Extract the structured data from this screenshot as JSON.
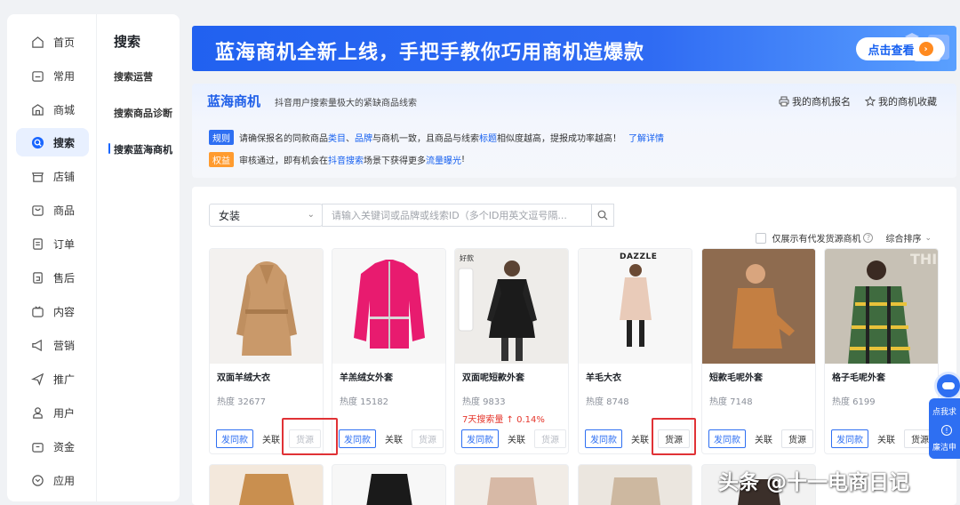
{
  "nav": {
    "items": [
      {
        "label": "首页",
        "icon": "home-icon"
      },
      {
        "label": "常用",
        "icon": "folder-icon"
      },
      {
        "label": "商城",
        "icon": "store-icon"
      },
      {
        "label": "搜索",
        "icon": "search-icon"
      },
      {
        "label": "店铺",
        "icon": "shop-icon"
      },
      {
        "label": "商品",
        "icon": "goods-icon"
      },
      {
        "label": "订单",
        "icon": "order-icon"
      },
      {
        "label": "售后",
        "icon": "aftersale-icon"
      },
      {
        "label": "内容",
        "icon": "tv-icon"
      },
      {
        "label": "营销",
        "icon": "megaphone-icon"
      },
      {
        "label": "推广",
        "icon": "promote-icon"
      },
      {
        "label": "用户",
        "icon": "user-icon"
      },
      {
        "label": "资金",
        "icon": "wallet-icon"
      },
      {
        "label": "应用",
        "icon": "apps-icon"
      }
    ],
    "active_index": 3
  },
  "subnav": {
    "title": "搜索",
    "items": [
      "搜索运营",
      "搜索商品诊断",
      "搜索蓝海商机"
    ],
    "active_index": 2
  },
  "banner": {
    "text": "蓝海商机全新上线，手把手教你巧用商机造爆款",
    "button": "点击查看"
  },
  "info": {
    "logo": "蓝海商机",
    "subtitle": "抖音用户搜索量极大的紧缺商品线索",
    "link_apply": "我的商机报名",
    "link_fav": "我的商机收藏",
    "rule_tag": "规则",
    "rule_text_1": "请确保报名的同款商品",
    "rule_hl_1": "类目",
    "rule_sep": "、",
    "rule_hl_2": "品牌",
    "rule_text_2": "与商机一致，且商品与线索",
    "rule_hl_3": "标题",
    "rule_text_3": "相似度越高，提报成功率越高！",
    "rule_link": "了解详情",
    "benefit_tag": "权益",
    "benefit_text_1": "审核通过，即有机会在",
    "benefit_hl_1": "抖音搜索",
    "benefit_text_2": "场景下获得更多",
    "benefit_hl_2": "流量曝光",
    "benefit_text_3": "!"
  },
  "filters": {
    "category": "女装",
    "search_placeholder": "请输入关键词或品牌或线索ID（多个ID用英文逗号隔...",
    "only_source_label": "仅展示有代发货源商机",
    "sort_label": "综合排序"
  },
  "buttons": {
    "same": "发同款",
    "relate": "关联",
    "source": "货源"
  },
  "products": [
    {
      "name": "双面羊绒大衣",
      "heat": "热度 32677",
      "trend": "",
      "source_enabled": false
    },
    {
      "name": "羊羔绒女外套",
      "heat": "热度 15182",
      "trend": "",
      "source_enabled": false
    },
    {
      "name": "双面呢短款外套",
      "heat": "热度 9833",
      "trend": "7天搜索量 ↑ 0.14%",
      "source_enabled": false
    },
    {
      "name": "羊毛大衣",
      "heat": "热度 8748",
      "trend": "",
      "source_enabled": true
    },
    {
      "name": "短款毛呢外套",
      "heat": "热度 7148",
      "trend": "",
      "source_enabled": true
    },
    {
      "name": "格子毛呢外套",
      "heat": "热度 6199",
      "trend": "",
      "source_enabled": true
    }
  ],
  "product_image_text": {
    "brand_dazzle": "DAZZLE",
    "img3_label": "好款",
    "img6_label": "THIS"
  },
  "float": {
    "line1": "点我求",
    "line2": "廉洁申"
  },
  "watermark": "头条 @十一电商日记",
  "colors": {
    "accent": "#1966ff",
    "warning": "#ff9b2f",
    "trend_red": "#e5362c",
    "highlight_box": "#e03236"
  }
}
